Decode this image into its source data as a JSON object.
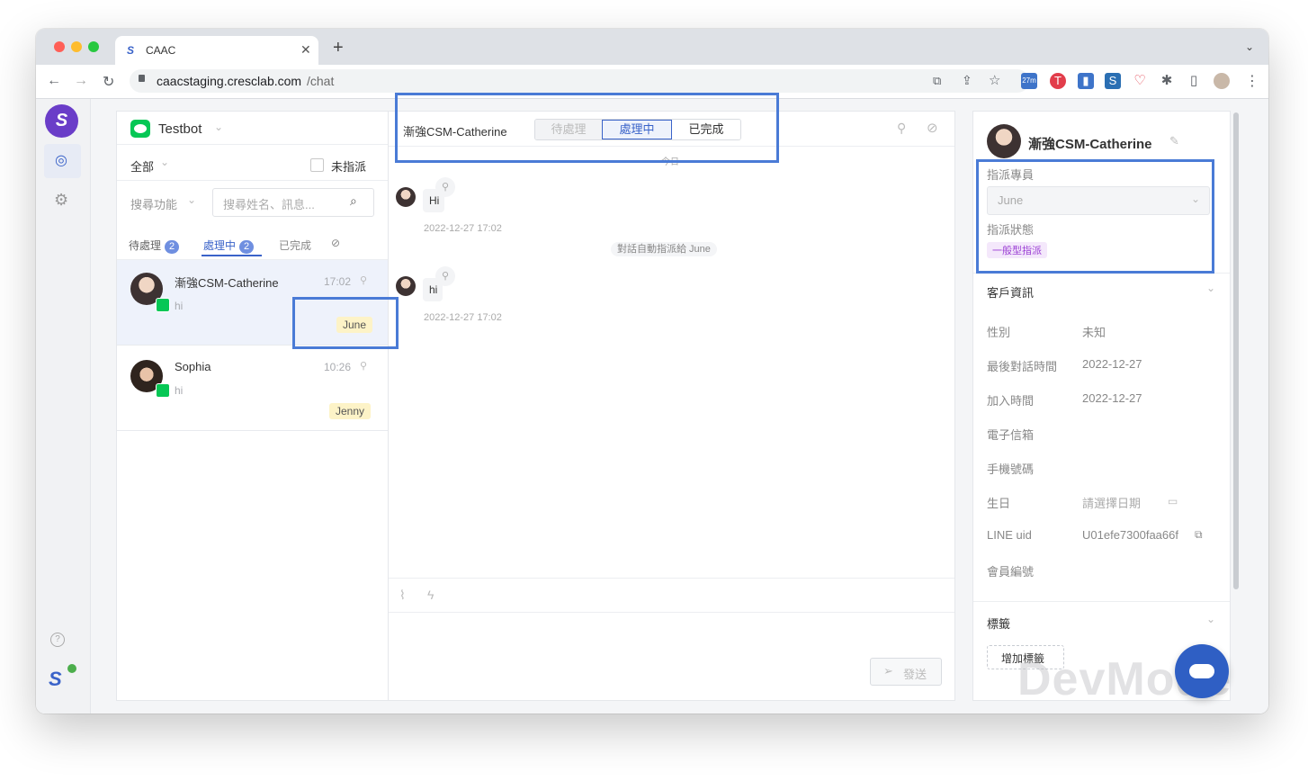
{
  "browser": {
    "tab_title": "CAAC",
    "url_host": "caacstaging.cresclab.com",
    "url_path": "/chat",
    "new_tab": "+",
    "ext_badge": "27m"
  },
  "inbox": {
    "channel_name": "Testbot",
    "filter_all": "全部",
    "unassigned_label": "未指派",
    "search_scope": "搜尋功能",
    "search_placeholder": "搜尋姓名、訊息...",
    "tabs": [
      {
        "label": "待處理",
        "count": "2"
      },
      {
        "label": "處理中",
        "count": "2"
      },
      {
        "label": "已完成"
      }
    ],
    "conversations": [
      {
        "name": "漸強CSM-Catherine",
        "time": "17:02",
        "preview": "hi",
        "assignee": "June"
      },
      {
        "name": "Sophia",
        "time": "10:26",
        "preview": "hi",
        "assignee": "Jenny"
      }
    ]
  },
  "chat": {
    "contact_name": "漸強CSM-Catherine",
    "status_buttons": [
      "待處理",
      "處理中",
      "已完成"
    ],
    "date_divider": "今日",
    "messages": [
      {
        "text": "Hi",
        "timestamp": "2022-12-27 17:02"
      },
      {
        "text": "hi",
        "timestamp": "2022-12-27 17:02"
      }
    ],
    "system_note": "對話自動指派給 June",
    "send_label": "發送"
  },
  "profile": {
    "name": "漸強CSM-Catherine",
    "assignee_label": "指派專員",
    "assignee_value": "June",
    "assign_status_label": "指派狀態",
    "assign_status_value": "一般型指派",
    "customer_info_title": "客戶資訊",
    "fields": [
      {
        "label": "性別",
        "value": "未知"
      },
      {
        "label": "最後對話時間",
        "value": "2022-12-27"
      },
      {
        "label": "加入時間",
        "value": "2022-12-27"
      },
      {
        "label": "電子信箱",
        "value": ""
      },
      {
        "label": "手機號碼",
        "value": ""
      },
      {
        "label": "生日",
        "value": "請選擇日期"
      },
      {
        "label": "LINE uid",
        "value": "U01efe7300faa66f"
      },
      {
        "label": "會員編號",
        "value": ""
      }
    ],
    "tags_title": "標籤",
    "add_tag_label": "增加標籤"
  },
  "watermark": "DevMode",
  "colors": {
    "accent": "#3a63c9",
    "highlight_box": "#4a7bd6",
    "line_green": "#06c755",
    "brand_purple": "#6a3dc8",
    "assign_tag": "#9b3fd4"
  }
}
